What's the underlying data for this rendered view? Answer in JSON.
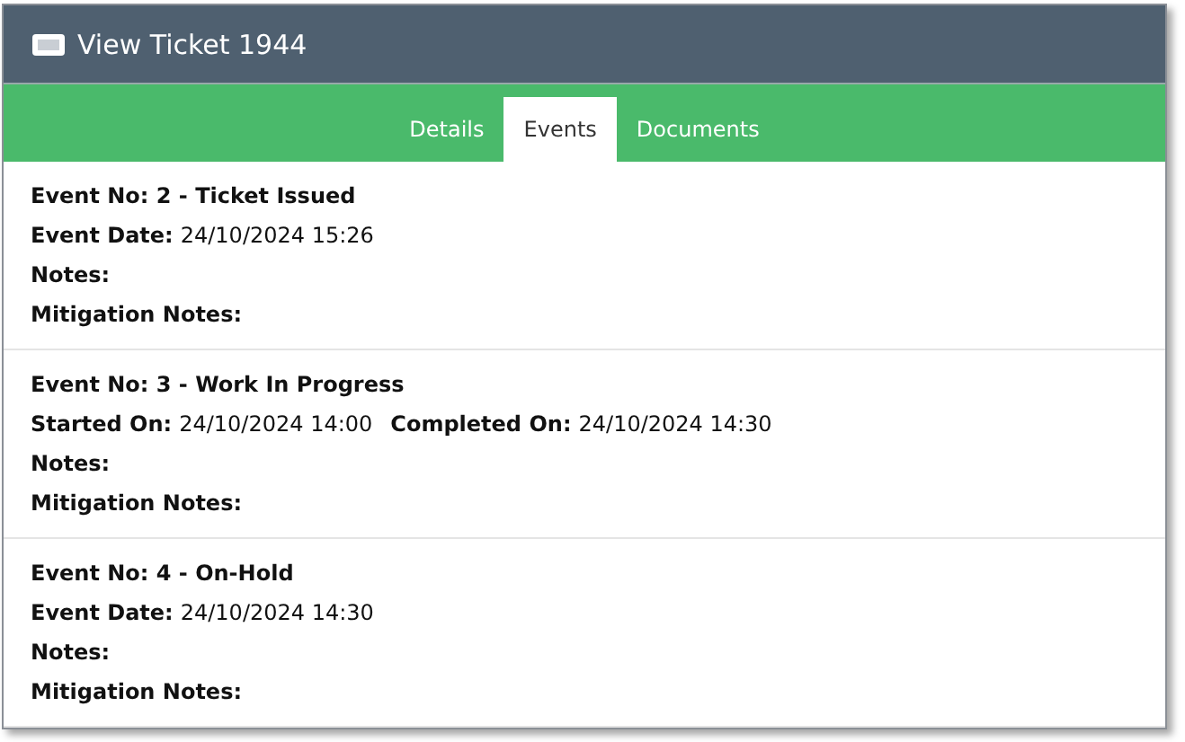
{
  "window": {
    "title": "View Ticket 1944"
  },
  "tabs": [
    {
      "label": "Details",
      "selected": false
    },
    {
      "label": "Events",
      "selected": true
    },
    {
      "label": "Documents",
      "selected": false
    }
  ],
  "events": [
    {
      "title": "Event No: 2 - Ticket Issued",
      "lines": [
        [
          {
            "label": "Event Date:",
            "value": "24/10/2024 15:26"
          }
        ],
        [
          {
            "label": "Notes:"
          }
        ],
        [
          {
            "label": "Mitigation Notes:"
          }
        ]
      ]
    },
    {
      "title": "Event No: 3 - Work In Progress",
      "lines": [
        [
          {
            "label": "Started On:",
            "value": "24/10/2024 14:00"
          },
          {
            "label": "Completed On:",
            "value": "24/10/2024 14:30"
          }
        ],
        [
          {
            "label": "Notes:"
          }
        ],
        [
          {
            "label": "Mitigation Notes:"
          }
        ]
      ]
    },
    {
      "title": "Event No: 4 - On-Hold",
      "lines": [
        [
          {
            "label": "Event Date:",
            "value": "24/10/2024 14:30"
          }
        ],
        [
          {
            "label": "Notes:"
          }
        ],
        [
          {
            "label": "Mitigation Notes:"
          }
        ]
      ]
    }
  ]
}
